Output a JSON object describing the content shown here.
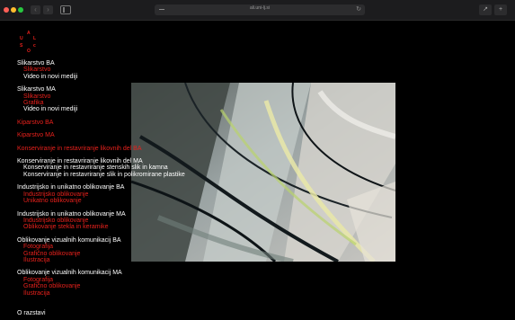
{
  "browser": {
    "url": "ali.uni-lj.si",
    "back_icon": "chevron-left-icon",
    "forward_icon": "chevron-right-icon"
  },
  "logo": {
    "letters": [
      "A",
      "L",
      "U",
      "O",
      "S",
      "c"
    ]
  },
  "menu": {
    "slikarstvo_ba": {
      "title": "Slikarstvo BA",
      "items": [
        "Slikarstvo",
        "Video in novi mediji"
      ]
    },
    "slikarstvo_ma": {
      "title": "Slikarstvo MA",
      "items": [
        "Slikarstvo",
        "Grafika",
        "Video in novi mediji"
      ]
    },
    "kiparstvo_ba": "Kiparstvo BA",
    "kiparstvo_ma": "Kiparstvo MA",
    "konserviranje_ba": "Konserviranje in restavriranje likovnih del BA",
    "konserviranje_ma": {
      "title": "Konserviranje in restavriranje likovnih del MA",
      "items": [
        "Konserviranje in restavriranje stenskih slik in kamna",
        "Konserviranje in restavriranje slik in polikromirane plastike"
      ]
    },
    "oblikovanje_ba": {
      "title": "Industrijsko in unikatno oblikovanje BA",
      "items": [
        "Industrijsko oblikovanje",
        "Unikatno oblikovanje"
      ]
    },
    "oblikovanje_ma": {
      "title": "Industrijsko in unikatno oblikovanje MA",
      "items": [
        "Industrijsko oblikovanje",
        "Oblikovanje stekla in keramike"
      ]
    },
    "vizualne_ba": {
      "title": "Oblikovanje vizualnih komunikacij BA",
      "items": [
        "Fotografija",
        "Grafično oblikovanje",
        "Ilustracija"
      ]
    },
    "vizualne_ma": {
      "title": "Oblikovanje vizualnih komunikacij MA",
      "items": [
        "Fotografija",
        "Grafično oblikovanje",
        "Ilustracija"
      ]
    },
    "o_razstavi": "O razstavi"
  },
  "colors": {
    "accent": "#e8211c",
    "background": "#000000",
    "text": "#ffffff"
  }
}
